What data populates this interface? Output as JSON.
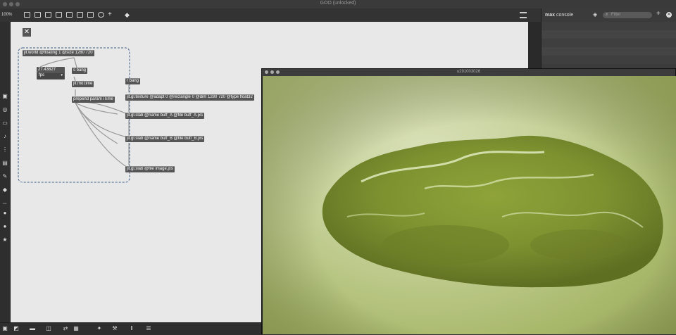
{
  "window": {
    "title": "GOO (unlocked)"
  },
  "toolbar": {
    "zoom": "100%",
    "icons": [
      "presentation-icon",
      "edit-icon",
      "comment-icon",
      "delete-icon",
      "object-icon",
      "inlet-icon",
      "outlet-icon",
      "clock-icon",
      "add-icon",
      "format-icon"
    ]
  },
  "left_toolbar": {
    "icons": [
      "cube-icon",
      "circle-icon",
      "slider-icon",
      "note-icon",
      "meter-icon",
      "image-icon",
      "attach-icon",
      "brush-icon",
      "swap-icon",
      "gear-icon",
      "bulb-icon",
      "star-icon"
    ]
  },
  "bottom_toolbar": {
    "icons": [
      "lock-icon",
      "cursor-icon",
      "chat-icon",
      "window-icon",
      "split-icon",
      "grid-icon",
      "pin-icon",
      "wrench-icon",
      "columns-icon",
      "layers-icon"
    ]
  },
  "patch": {
    "objects": [
      {
        "id": "jit-world",
        "text": "jit.world @floating 1 @size 1280 720"
      },
      {
        "id": "fps-value",
        "text": "27.43827"
      },
      {
        "id": "fps-menu",
        "text": "fps"
      },
      {
        "id": "s-bang",
        "text": "s bang"
      },
      {
        "id": "jit-mo-time",
        "text": "jit.mo.time"
      },
      {
        "id": "prepend-param",
        "text": "prepend param iTime"
      },
      {
        "id": "r-bang",
        "text": "r bang"
      },
      {
        "id": "jit-gl-texture",
        "text": "jit.gl.texture @adapt 0 @rectangle 0 @dim 1280 720 @type float32"
      },
      {
        "id": "slab-buff-a",
        "text": "jit.gl.slab @name buff_A @file buff_A.jxs"
      },
      {
        "id": "slab-buff-b",
        "text": "jit.gl.slab @name buff_B @file buff_B.jxs"
      },
      {
        "id": "slab-image",
        "text": "jit.gl.slab @file image.jxs"
      }
    ]
  },
  "console": {
    "title_bold": "max",
    "title_rest": " console",
    "filter_placeholder": "Filter"
  },
  "viewer": {
    "title": "u291003026"
  },
  "colors": {
    "canvas": "#e8e8e8",
    "object": "#555555",
    "chrome": "#2e2e2e",
    "scene_green": "#a9b96c"
  }
}
